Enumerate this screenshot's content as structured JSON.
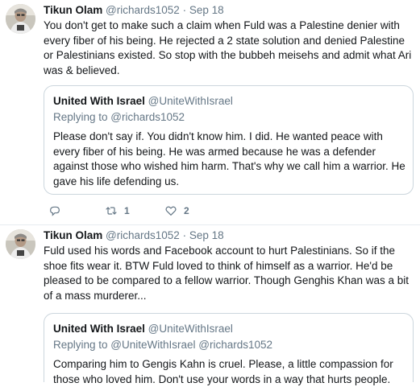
{
  "tweets": [
    {
      "author": {
        "name": "Tikun Olam",
        "handle": "@richards1052",
        "separator": "·",
        "date": "Sep 18"
      },
      "text": "You don't get to make such a claim when Fuld was a Palestine denier with every fiber of his being. He rejected a 2 state solution and denied Palestine or Palestinians existed. So stop with the bubbeh meisehs and admit what Ari was & believed.",
      "quoted": {
        "name": "United With Israel",
        "handle": "@UniteWithIsrael",
        "replying_prefix": "Replying to ",
        "replying_to": "@richards1052",
        "text": "Please don't say if. You didn't know him. I did. He wanted peace with every fiber of his being. He was armed because he was a defender against those who wished him harm. That's why we call him a warrior. He gave his life defending us."
      },
      "actions": {
        "reply_icon": "reply-icon",
        "retweet_icon": "retweet-icon",
        "retweet_count": "1",
        "like_icon": "heart-icon",
        "like_count": "2"
      }
    },
    {
      "author": {
        "name": "Tikun Olam",
        "handle": "@richards1052",
        "separator": "·",
        "date": "Sep 18"
      },
      "text": "Fuld used his words and Facebook account to hurt Palestinians. So if the shoe fits wear it.  BTW Fuld loved to think of himself as a warrior. He'd be pleased to be compared to a fellow warrior. Though Genghis Khan was a bit of a mass murderer...",
      "quoted": {
        "name": "United With Israel",
        "handle": "@UniteWithIsrael",
        "replying_prefix": "Replying to ",
        "replying_to": "@UniteWithIsrael @richards1052",
        "text": "Comparing him to Gengis Kahn is cruel. Please, a little compassion for those who loved him. Don't use your words in a way that hurts people."
      }
    }
  ],
  "colors": {
    "text": "#14171a",
    "secondary": "#657786",
    "border": "#ccd6dd",
    "divider": "#e6ecf0"
  }
}
